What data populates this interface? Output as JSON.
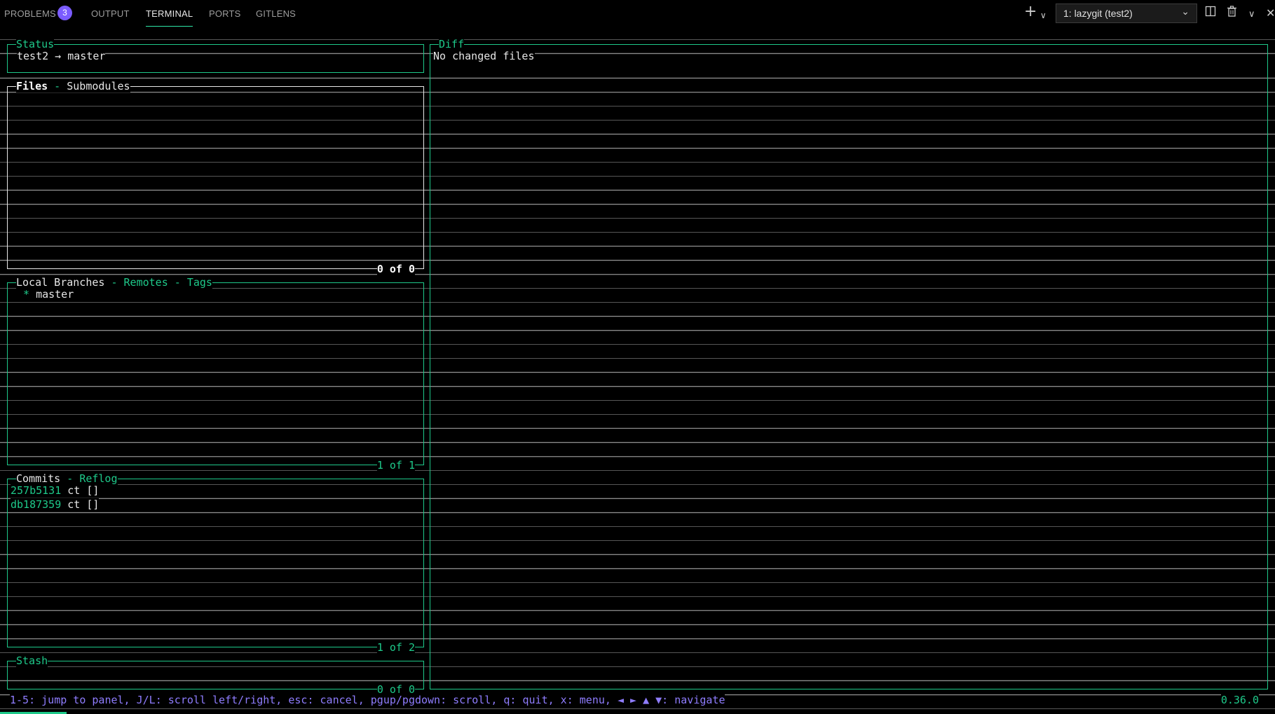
{
  "tabs": [
    {
      "label": "PROBLEMS",
      "badge": "3"
    },
    {
      "label": "OUTPUT"
    },
    {
      "label": "TERMINAL",
      "active": true
    },
    {
      "label": "PORTS"
    },
    {
      "label": "GITLENS"
    }
  ],
  "toolbar": {
    "new_terminal_icon": "plus-icon",
    "terminal_select_value": "1: lazygit (test2)",
    "split_icon": "split-terminal-icon",
    "kill_icon": "trash-icon",
    "more_icon": "chevron-down-icon",
    "close_icon": "close-icon"
  },
  "lazygit": {
    "status": {
      "title": "Status",
      "content": "test2 → master"
    },
    "files": {
      "title_active": "Files",
      "title_sep": " - ",
      "title_other": "Submodules",
      "count": "0 of 0"
    },
    "branches": {
      "title_active": "Local Branches",
      "title_sep1": " - ",
      "title_remotes": "Remotes",
      "title_sep2": " - ",
      "title_tags": "Tags",
      "items": [
        {
          "marker": "*",
          "name": "master"
        }
      ],
      "count": "1 of 1"
    },
    "commits": {
      "title_active": "Commits",
      "title_sep": " - ",
      "title_other": "Reflog",
      "items": [
        {
          "hash": "257b5131",
          "message": " ct []"
        },
        {
          "hash": "db187359",
          "message": " ct []"
        }
      ],
      "count": "1 of 2"
    },
    "stash": {
      "title": "Stash",
      "count": "0 of 0"
    },
    "diff": {
      "title": "Diff",
      "content": "No changed files"
    },
    "footer": "1-5: jump to panel, J/L: scroll left/right, esc: cancel, pgup/pgdown: scroll, q: quit, x: menu, ◄ ► ▲ ▼: navigate",
    "version": "0.36.0"
  },
  "colors": {
    "accent": "#1ec98a",
    "footer": "#8f7dff",
    "badge": "#7b5cff"
  }
}
